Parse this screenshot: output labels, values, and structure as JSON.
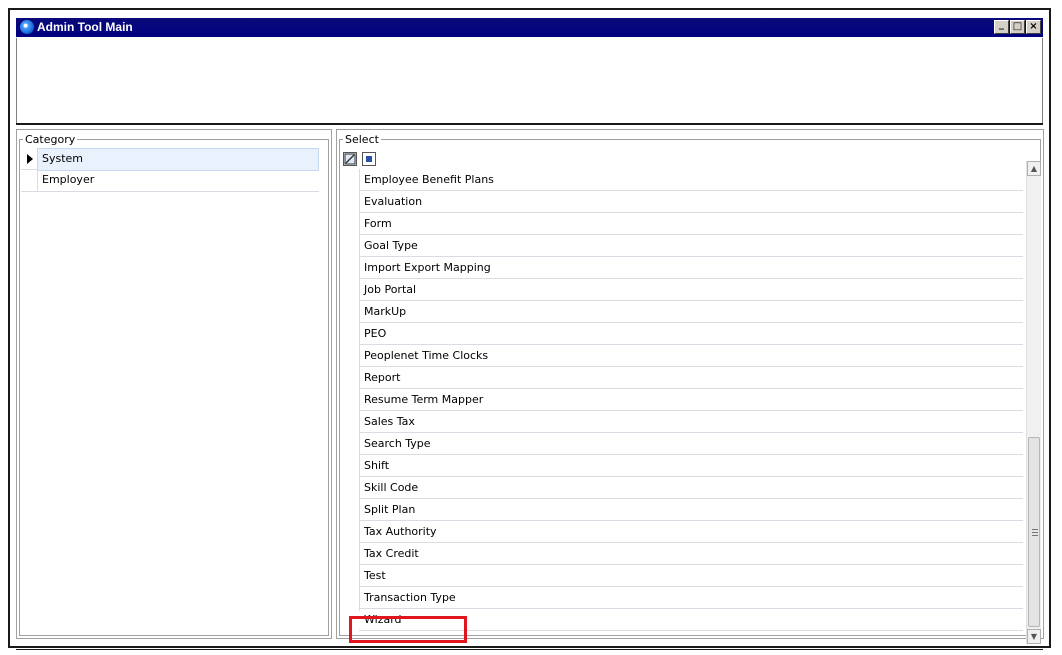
{
  "window": {
    "title": "Admin Tool Main",
    "controls": {
      "minimize": "_",
      "maximize": "□",
      "close": "×"
    }
  },
  "category": {
    "label": "Category",
    "items": [
      {
        "label": "System",
        "selected": true
      },
      {
        "label": "Employer",
        "selected": false
      }
    ]
  },
  "select": {
    "label": "Select",
    "items": [
      "Employee Benefit Plans",
      "Evaluation",
      "Form",
      "Goal Type",
      "Import Export Mapping",
      "Job Portal",
      "MarkUp",
      "PEO",
      "Peoplenet Time Clocks",
      "Report",
      "Resume Term Mapper",
      "Sales Tax",
      "Search Type",
      "Shift",
      "Skill Code",
      "Split Plan",
      "Tax Authority",
      "Tax Credit",
      "Test",
      "Transaction Type",
      "Wizard"
    ],
    "highlighted": "Wizard"
  },
  "colors": {
    "titlebar": "#000080",
    "selection": "#e9f2fc",
    "highlight_box": "#e0161e"
  },
  "icons": [
    "app-icon",
    "minimize-icon",
    "maximize-icon",
    "close-icon",
    "row-indicator-icon",
    "edit-icon",
    "select-all-icon",
    "scroll-up-icon",
    "scroll-down-icon"
  ]
}
